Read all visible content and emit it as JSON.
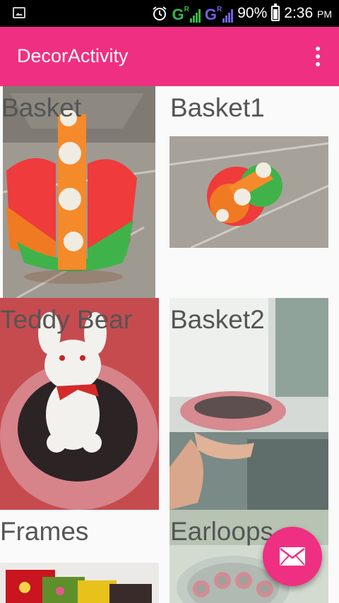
{
  "status_bar": {
    "network_1": "G",
    "network_1_roaming": "R",
    "network_2": "G",
    "network_2_roaming": "R",
    "battery": "90%",
    "time": "2:36",
    "time_suffix": "PM",
    "icons": [
      "gallery-notification-icon",
      "alarm-icon",
      "signal-icon",
      "battery-icon"
    ]
  },
  "app_bar": {
    "title": "DecorActivity",
    "overflow_icon": "more-vertical-icon"
  },
  "grid": {
    "items": [
      {
        "label": "Basket"
      },
      {
        "label": "Basket1"
      },
      {
        "label": "Teddy Bear"
      },
      {
        "label": "Basket2"
      },
      {
        "label": "Frames"
      },
      {
        "label": "Earloops"
      }
    ]
  },
  "fab": {
    "icon": "mail-icon"
  },
  "colors": {
    "accent": "#ef2f82",
    "status_bar": "#000000",
    "network_1": "#3ab54a",
    "network_2": "#6f63e0"
  }
}
